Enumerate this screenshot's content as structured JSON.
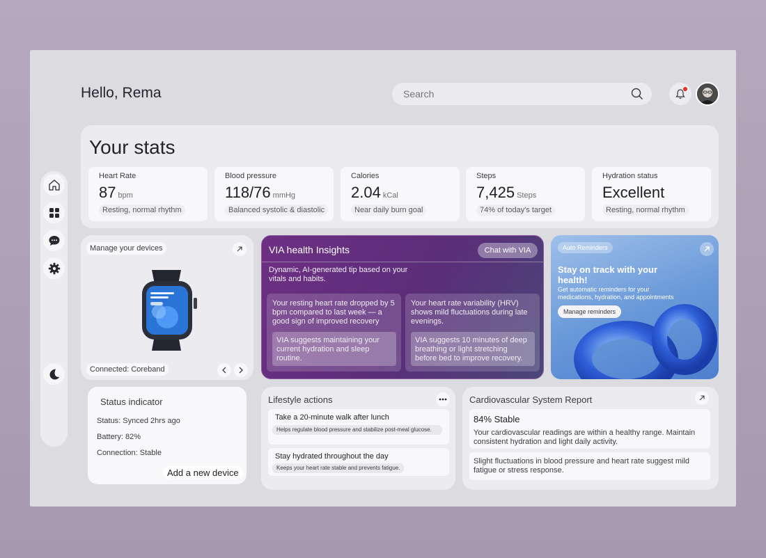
{
  "header": {
    "greeting": "Hello, Rema",
    "search_placeholder": "Search"
  },
  "stats": {
    "title": "Your stats",
    "items": [
      {
        "label": "Heart Rate",
        "value": "87",
        "unit": "bpm",
        "note": "Resting, normal rhythm"
      },
      {
        "label": "Blood pressure",
        "value": "118/76",
        "unit": "mmHg",
        "note": "Balanced systolic & diastolic"
      },
      {
        "label": "Calories",
        "value": "2.04",
        "unit": "kCal",
        "note": "Near daily burn goal"
      },
      {
        "label": "Steps",
        "value": "7,425",
        "unit": "Steps",
        "note": "74% of today's target"
      },
      {
        "label": "Hydration status",
        "value": "Excellent",
        "unit": "",
        "note": "Resting, normal rhythm"
      }
    ]
  },
  "devices": {
    "title": "Manage your devices",
    "connected": "Connected: Coreband",
    "watch_text": "Stay on track with your health"
  },
  "status": {
    "title": "Status indicator",
    "status": "Status:   Synced 2hrs ago",
    "battery": "Battery: 82%",
    "connection": "Connection: Stable",
    "add": "Add a new device"
  },
  "via": {
    "title": "VIA health Insights",
    "chat": "Chat with VIA",
    "desc": "Dynamic, AI-generated tip based on your vitals and habits.",
    "tips": [
      {
        "text": "Your resting heart rate dropped by 5 bpm compared to last week — a good sign of improved recovery",
        "suggest": "VIA suggests maintaining your current hydration and sleep routine."
      },
      {
        "text": "Your heart rate variability (HRV) shows mild fluctuations during late evenings.",
        "suggest": "VIA suggests 10 minutes of deep breathing or light stretching before bed to improve recovery."
      }
    ]
  },
  "reminders": {
    "pill": "Auto Reminders",
    "heading": "Stay on track with your health!",
    "body": "Get automatic reminders for your medications, hydration, and appointments",
    "button": "Manage reminders"
  },
  "lifestyle": {
    "title": "Lifestyle actions",
    "items": [
      {
        "action": "Take a 20-minute walk after lunch",
        "benefit": "Helps regulate blood pressure and stabilize post-meal glucose."
      },
      {
        "action": "Stay hydrated throughout the day",
        "benefit": "Keeps your heart rate stable and prevents fatigue."
      }
    ]
  },
  "cardio": {
    "title": "Cardiovascular System Report",
    "stable": "84% Stable",
    "summary": "Your cardiovascular readings are within a healthy range. Maintain consistent hydration and light daily activity.",
    "note": "Slight fluctuations in blood pressure and heart rate suggest mild fatigue or stress response."
  },
  "colors": {
    "accent_purple": "#6e2f83",
    "accent_blue": "#4d7fcf",
    "alert_red": "#e0322c"
  }
}
